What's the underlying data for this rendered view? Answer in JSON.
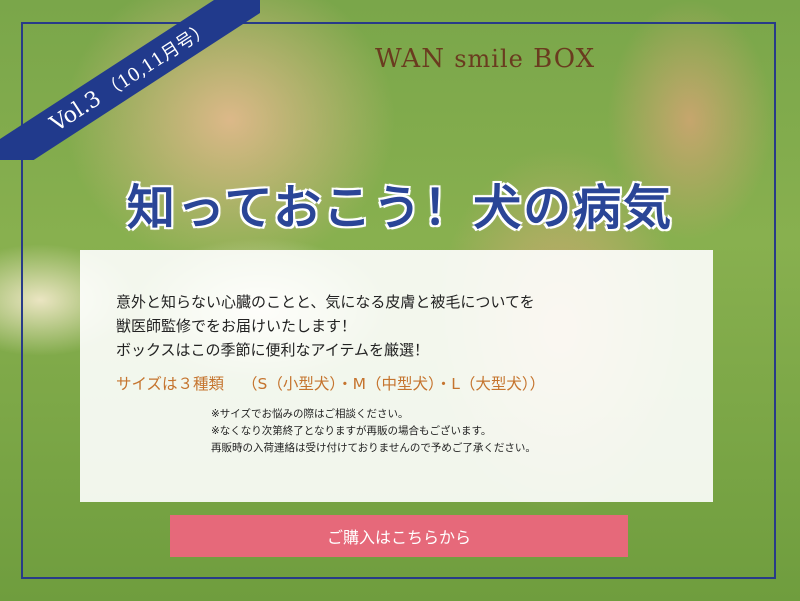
{
  "ribbon": {
    "vol": "Vol.3",
    "issue": "（10,11月号）"
  },
  "brand": {
    "part1": "WAN",
    "part2": "smile",
    "part3": "BOX"
  },
  "headline": "知っておこう！犬の病気",
  "panel": {
    "lines": [
      "意外と知らない心臓のことと、気になる皮膚と被毛についてを",
      "獣医師監修でをお届けいたします！",
      "ボックスはこの季節に便利なアイテムを厳選！"
    ],
    "sizes_label": "サイズは３種類",
    "sizes_options": "（S（小型犬）・M（中型犬）・L（大型犬））",
    "notes": [
      "※サイズでお悩みの際はご相談ください。",
      "※なくなり次第終了となりますが再販の場合もございます。",
      "再販時の入荷連絡は受け付けておりませんので予めご了承ください。"
    ]
  },
  "cta": {
    "label": "ご購入はこちらから"
  },
  "colors": {
    "navy": "#283b88",
    "brown": "#6a3b1f",
    "orange": "#c5742e",
    "pink": "#e6697a"
  }
}
